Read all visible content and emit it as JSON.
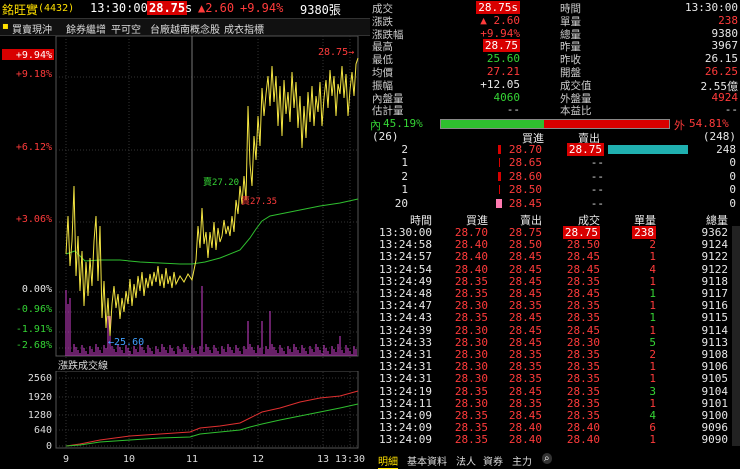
{
  "header": {
    "name": "銘旺實",
    "code": "(4432)",
    "time": "13:30:00",
    "price": "28.75",
    "price_flag": "s",
    "change": "▲2.60",
    "change_pct": "+9.94%",
    "volume": "9380張"
  },
  "toolbar": [
    "買賣現沖",
    "餘券繼增",
    "平可空",
    "台廠越南概念股",
    "成衣指標"
  ],
  "chart": {
    "y_labels": [
      {
        "t": "+9.94%",
        "c": "red",
        "hl": true
      },
      {
        "t": "+9.18%",
        "c": "red"
      },
      {
        "t": "+6.12%",
        "c": "red"
      },
      {
        "t": "+3.06%",
        "c": "red"
      },
      {
        "t": "0.00%",
        "c": "white"
      },
      {
        "t": "-0.96%",
        "c": "green"
      },
      {
        "t": "-1.91%",
        "c": "green"
      },
      {
        "t": "-2.68%",
        "c": "green"
      }
    ],
    "ann_high": "28.75→",
    "ann_low": "←25.60",
    "ann_27_20": "賣27.20",
    "ann_27_35": "賣27.35",
    "vol_title": "漲跌成交線",
    "vol_labels": [
      "2560",
      "1920",
      "1280",
      "640",
      "0"
    ],
    "x_labels": [
      "9",
      "10",
      "11",
      "12",
      "13",
      "13:30"
    ]
  },
  "quote": {
    "left": [
      {
        "l": "成交",
        "v": "28.75s",
        "c": "hl"
      },
      {
        "l": "漲跌",
        "v": "▲ 2.60",
        "c": "red"
      },
      {
        "l": "漲跌幅",
        "v": "+9.94%",
        "c": "red"
      },
      {
        "l": "最高",
        "v": "28.75",
        "c": "hl"
      },
      {
        "l": "最低",
        "v": "25.60",
        "c": "green"
      },
      {
        "l": "均價",
        "v": "27.21",
        "c": "red"
      },
      {
        "l": "振幅",
        "v": "+12.05",
        "c": "white"
      },
      {
        "l": "內盤量",
        "v": "4060",
        "c": "green"
      },
      {
        "l": "估計量",
        "v": "--",
        "c": "white"
      }
    ],
    "right": [
      {
        "l": "時間",
        "v": "13:30:00",
        "c": "white"
      },
      {
        "l": "單量",
        "v": "238",
        "c": "red"
      },
      {
        "l": "總量",
        "v": "9380",
        "c": "white"
      },
      {
        "l": "昨量",
        "v": "3967",
        "c": "white"
      },
      {
        "l": "昨收",
        "v": "26.15",
        "c": "white"
      },
      {
        "l": "開盤",
        "v": "26.25",
        "c": "red"
      },
      {
        "l": "成交值",
        "v": "2.55億",
        "c": "white"
      },
      {
        "l": "外盤量",
        "v": "4924",
        "c": "red"
      },
      {
        "l": "本益比",
        "v": "--",
        "c": "white"
      }
    ],
    "inner_label": "內",
    "inner_pct": "45.19%",
    "inner_ratio": 0.4519,
    "outer_label": "外",
    "outer_pct": "54.81%"
  },
  "book": {
    "bid_total": "(26)",
    "ask_total": "(248)",
    "h_bid": "買進",
    "h_ask": "賣出",
    "rows": [
      {
        "bq": "2",
        "bp": "28.70",
        "ap": "28.75",
        "aq": "248",
        "bw": 0.4,
        "aw": 1.0
      },
      {
        "bq": "1",
        "bp": "28.65",
        "ap": "--",
        "aq": "0",
        "bw": 0.2,
        "aw": 0
      },
      {
        "bq": "2",
        "bp": "28.60",
        "ap": "--",
        "aq": "0",
        "bw": 0.4,
        "aw": 0
      },
      {
        "bq": "1",
        "bp": "28.50",
        "ap": "--",
        "aq": "0",
        "bw": 0.2,
        "aw": 0
      },
      {
        "bq": "20",
        "bp": "28.45",
        "ap": "--",
        "aq": "0",
        "bw": 1.0,
        "aw": 0
      }
    ]
  },
  "ticks": {
    "headers": [
      "時間",
      "買進",
      "賣出",
      "成交",
      "單量",
      "總量"
    ],
    "rows": [
      [
        "13:30:00",
        "28.70",
        "28.75",
        "28.75",
        "238",
        "9362",
        "r",
        "r",
        "hl",
        "hl",
        "r"
      ],
      [
        "13:24:58",
        "28.40",
        "28.50",
        "28.50",
        "2",
        "9124",
        "r",
        "r",
        "r",
        "r",
        "r"
      ],
      [
        "13:24:57",
        "28.40",
        "28.45",
        "28.45",
        "1",
        "9122",
        "r",
        "r",
        "r",
        "r",
        "r"
      ],
      [
        "13:24:54",
        "28.40",
        "28.45",
        "28.45",
        "4",
        "9122",
        "r",
        "r",
        "r",
        "r",
        "r"
      ],
      [
        "13:24:49",
        "28.35",
        "28.45",
        "28.35",
        "1",
        "9118",
        "r",
        "r",
        "r",
        "r",
        "r"
      ],
      [
        "13:24:48",
        "28.35",
        "28.45",
        "28.45",
        "1",
        "9117",
        "r",
        "r",
        "r",
        "r",
        "g"
      ],
      [
        "13:24:47",
        "28.30",
        "28.35",
        "28.35",
        "1",
        "9116",
        "r",
        "r",
        "r",
        "r",
        "r"
      ],
      [
        "13:24:43",
        "28.35",
        "28.45",
        "28.35",
        "1",
        "9115",
        "r",
        "r",
        "r",
        "r",
        "g"
      ],
      [
        "13:24:39",
        "28.30",
        "28.45",
        "28.45",
        "1",
        "9114",
        "r",
        "r",
        "r",
        "r",
        "r"
      ],
      [
        "13:24:33",
        "28.30",
        "28.45",
        "28.30",
        "5",
        "9113",
        "r",
        "r",
        "r",
        "r",
        "g"
      ],
      [
        "13:24:31",
        "28.30",
        "28.35",
        "28.35",
        "2",
        "9108",
        "r",
        "r",
        "r",
        "r",
        "r"
      ],
      [
        "13:24:31",
        "28.30",
        "28.35",
        "28.35",
        "1",
        "9106",
        "r",
        "r",
        "r",
        "r",
        "r"
      ],
      [
        "13:24:31",
        "28.30",
        "28.35",
        "28.35",
        "1",
        "9105",
        "r",
        "r",
        "r",
        "r",
        "r"
      ],
      [
        "13:24:19",
        "28.35",
        "28.45",
        "28.35",
        "3",
        "9104",
        "r",
        "r",
        "r",
        "r",
        "g"
      ],
      [
        "13:24:11",
        "28.30",
        "28.35",
        "28.35",
        "1",
        "9101",
        "r",
        "r",
        "r",
        "r",
        "r"
      ],
      [
        "13:24:09",
        "28.35",
        "28.45",
        "28.35",
        "4",
        "9100",
        "r",
        "r",
        "r",
        "r",
        "g"
      ],
      [
        "13:24:09",
        "28.35",
        "28.40",
        "28.40",
        "6",
        "9096",
        "r",
        "r",
        "r",
        "r",
        "r"
      ],
      [
        "13:24:09",
        "28.35",
        "28.40",
        "28.40",
        "1",
        "9090",
        "r",
        "r",
        "r",
        "r",
        "r"
      ]
    ]
  },
  "tabs": [
    "明細",
    "基本資料",
    "法人",
    "資券",
    "主力"
  ]
}
